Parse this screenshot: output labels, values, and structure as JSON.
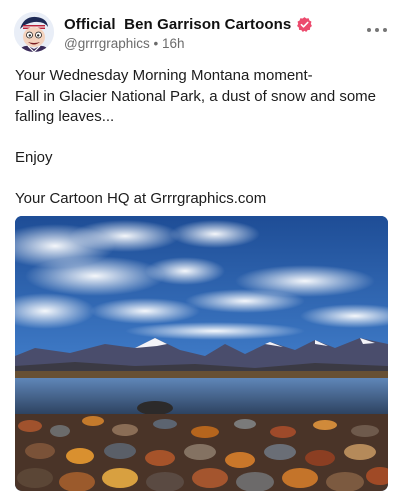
{
  "post": {
    "author_name": "Official  Ben Garrison Cartoons",
    "handle": "@grrrgraphics",
    "separator": "•",
    "time_ago": "16h",
    "caption_lines": [
      "Your Wednesday Morning Montana moment-",
      "Fall in Glacier National Park, a dust of snow and some falling leaves...",
      "",
      "Enjoy",
      "",
      "Your Cartoon HQ at Grrrgraphics.com"
    ]
  },
  "icons": {
    "verified": "verified-badge-icon",
    "more": "more-options-icon",
    "avatar": "avatar-image"
  },
  "colors": {
    "verified_badge": "#ec4a6d",
    "meta_text": "#6b6b6b",
    "sky": "#2d5fa3"
  }
}
